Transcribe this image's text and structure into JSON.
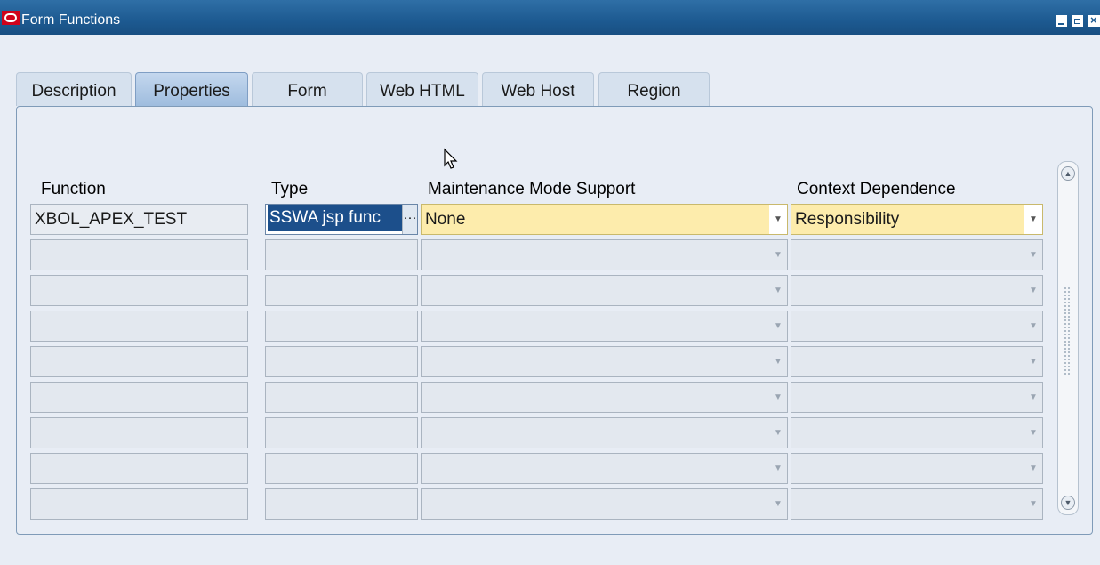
{
  "window": {
    "title": "Form Functions"
  },
  "tabs": [
    {
      "label": "Description",
      "active": false
    },
    {
      "label": "Properties",
      "active": true
    },
    {
      "label": "Form",
      "active": false
    },
    {
      "label": "Web HTML",
      "active": false
    },
    {
      "label": "Web Host",
      "active": false
    },
    {
      "label": "Region",
      "active": false
    }
  ],
  "columns": {
    "function": "Function",
    "type": "Type",
    "maintenance": "Maintenance Mode Support",
    "context": "Context Dependence"
  },
  "rows": [
    {
      "function": "XBOL_APEX_TEST",
      "type": "SSWA jsp func",
      "maintenance": "None",
      "context": "Responsibility"
    },
    {
      "function": "",
      "type": "",
      "maintenance": "",
      "context": ""
    },
    {
      "function": "",
      "type": "",
      "maintenance": "",
      "context": ""
    },
    {
      "function": "",
      "type": "",
      "maintenance": "",
      "context": ""
    },
    {
      "function": "",
      "type": "",
      "maintenance": "",
      "context": ""
    },
    {
      "function": "",
      "type": "",
      "maintenance": "",
      "context": ""
    },
    {
      "function": "",
      "type": "",
      "maintenance": "",
      "context": ""
    },
    {
      "function": "",
      "type": "",
      "maintenance": "",
      "context": ""
    },
    {
      "function": "",
      "type": "",
      "maintenance": "",
      "context": ""
    }
  ],
  "colors": {
    "titlebar": "#1d5a91",
    "required_field": "#fdecac",
    "selection": "#1c4f8b"
  },
  "icons": {
    "window_logo": "oracle-logo-icon",
    "lov_button": "ellipsis-icon",
    "dropdown": "chevron-down-icon",
    "pointer": "mouse-pointer-icon"
  }
}
